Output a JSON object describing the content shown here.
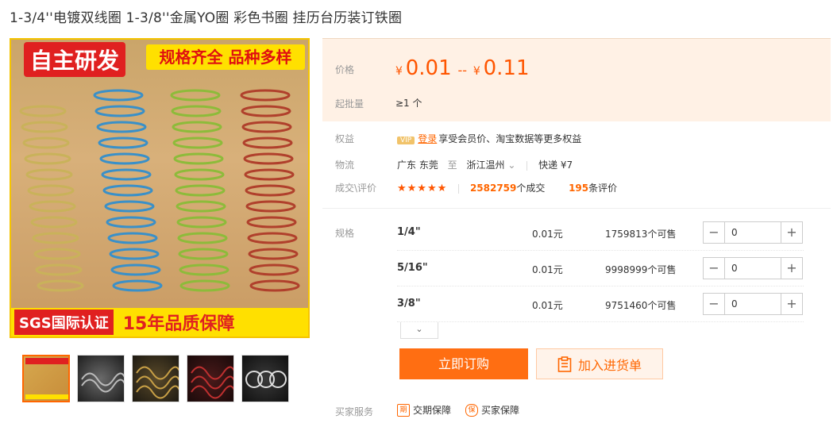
{
  "title": "1-3/4''电镀双线圈 1-3/8''金属YO圈 彩色书圈 挂历台历装订铁圈",
  "image": {
    "banner_left": "自主研发",
    "banner_right": "规格齐全 品种多样",
    "bottom_left": "SGS国际认证",
    "bottom_right": "15年品质保障"
  },
  "price": {
    "label": "价格",
    "currency": "¥",
    "low": "0.01",
    "high": "0.11",
    "separator": "--"
  },
  "min_order": {
    "label": "起批量",
    "value": "≥1 个"
  },
  "benefits": {
    "label": "权益",
    "vip": "VIP",
    "login": "登录",
    "text": "享受会员价、淘宝数据等更多权益"
  },
  "logistics": {
    "label": "物流",
    "from": "广东 东莞",
    "to_word": "至",
    "to": "浙江温州",
    "express": "快递 ¥7"
  },
  "deals": {
    "label": "成交\\评价",
    "stars": "★★★★★",
    "count": "2582759",
    "count_unit": "个成交",
    "reviews": "195",
    "reviews_unit": "条评价"
  },
  "spec_label": "规格",
  "specs": [
    {
      "name": "1/4\"",
      "price": "0.01元",
      "stock": "1759813个可售",
      "qty": "0"
    },
    {
      "name": "5/16\"",
      "price": "0.01元",
      "stock": "9998999个可售",
      "qty": "0"
    },
    {
      "name": "3/8\"",
      "price": "0.01元",
      "stock": "9751460个可售",
      "qty": "0"
    }
  ],
  "stepper": {
    "minus": "−",
    "plus": "+"
  },
  "more": "⌄",
  "buttons": {
    "buy": "立即订购",
    "cart": "加入进货单"
  },
  "services": {
    "label": "买家服务",
    "item1": "交期保障",
    "item2": "买家保障",
    "icon1": "期",
    "icon2": "保"
  },
  "colors": {
    "accent": "#ff6e12",
    "price": "#ff5000"
  }
}
